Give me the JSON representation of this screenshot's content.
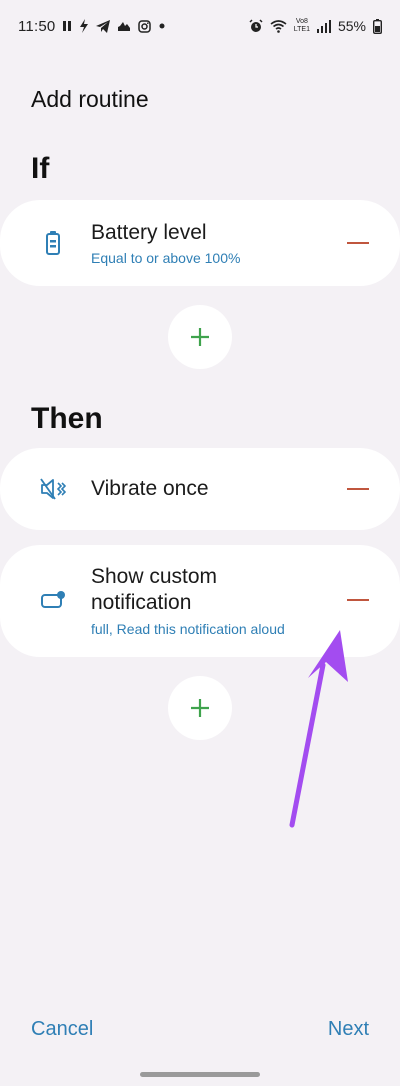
{
  "status_bar": {
    "time": "11:50",
    "left_icons": [
      "pause-icon",
      "bolt-icon",
      "telegram-icon",
      "cloud-icon",
      "instagram-icon",
      "dot-icon"
    ],
    "right_icons": [
      "alarm-icon",
      "wifi-icon",
      "volte-icon",
      "signal-icon"
    ],
    "volte_top": "Vo8",
    "volte_bottom": "LTE1",
    "battery": "55%"
  },
  "page": {
    "title": "Add routine"
  },
  "if_section": {
    "label": "If",
    "items": [
      {
        "title": "Battery level",
        "subtitle": "Equal to or above 100%",
        "icon": "battery-icon"
      }
    ]
  },
  "then_section": {
    "label": "Then",
    "items": [
      {
        "title": "Vibrate once",
        "icon": "vibrate-icon"
      },
      {
        "title_line1": "Show custom",
        "title_line2": "notification",
        "subtitle": "full, Read this notification aloud",
        "icon": "notification-icon"
      }
    ]
  },
  "footer": {
    "cancel_label": "Cancel",
    "next_label": "Next"
  },
  "colors": {
    "background": "#f4f1f5",
    "accent_blue": "#2f7fb5",
    "remove_red": "#c0563e",
    "add_green": "#3fa34d",
    "arrow_purple": "#a34cf0"
  }
}
